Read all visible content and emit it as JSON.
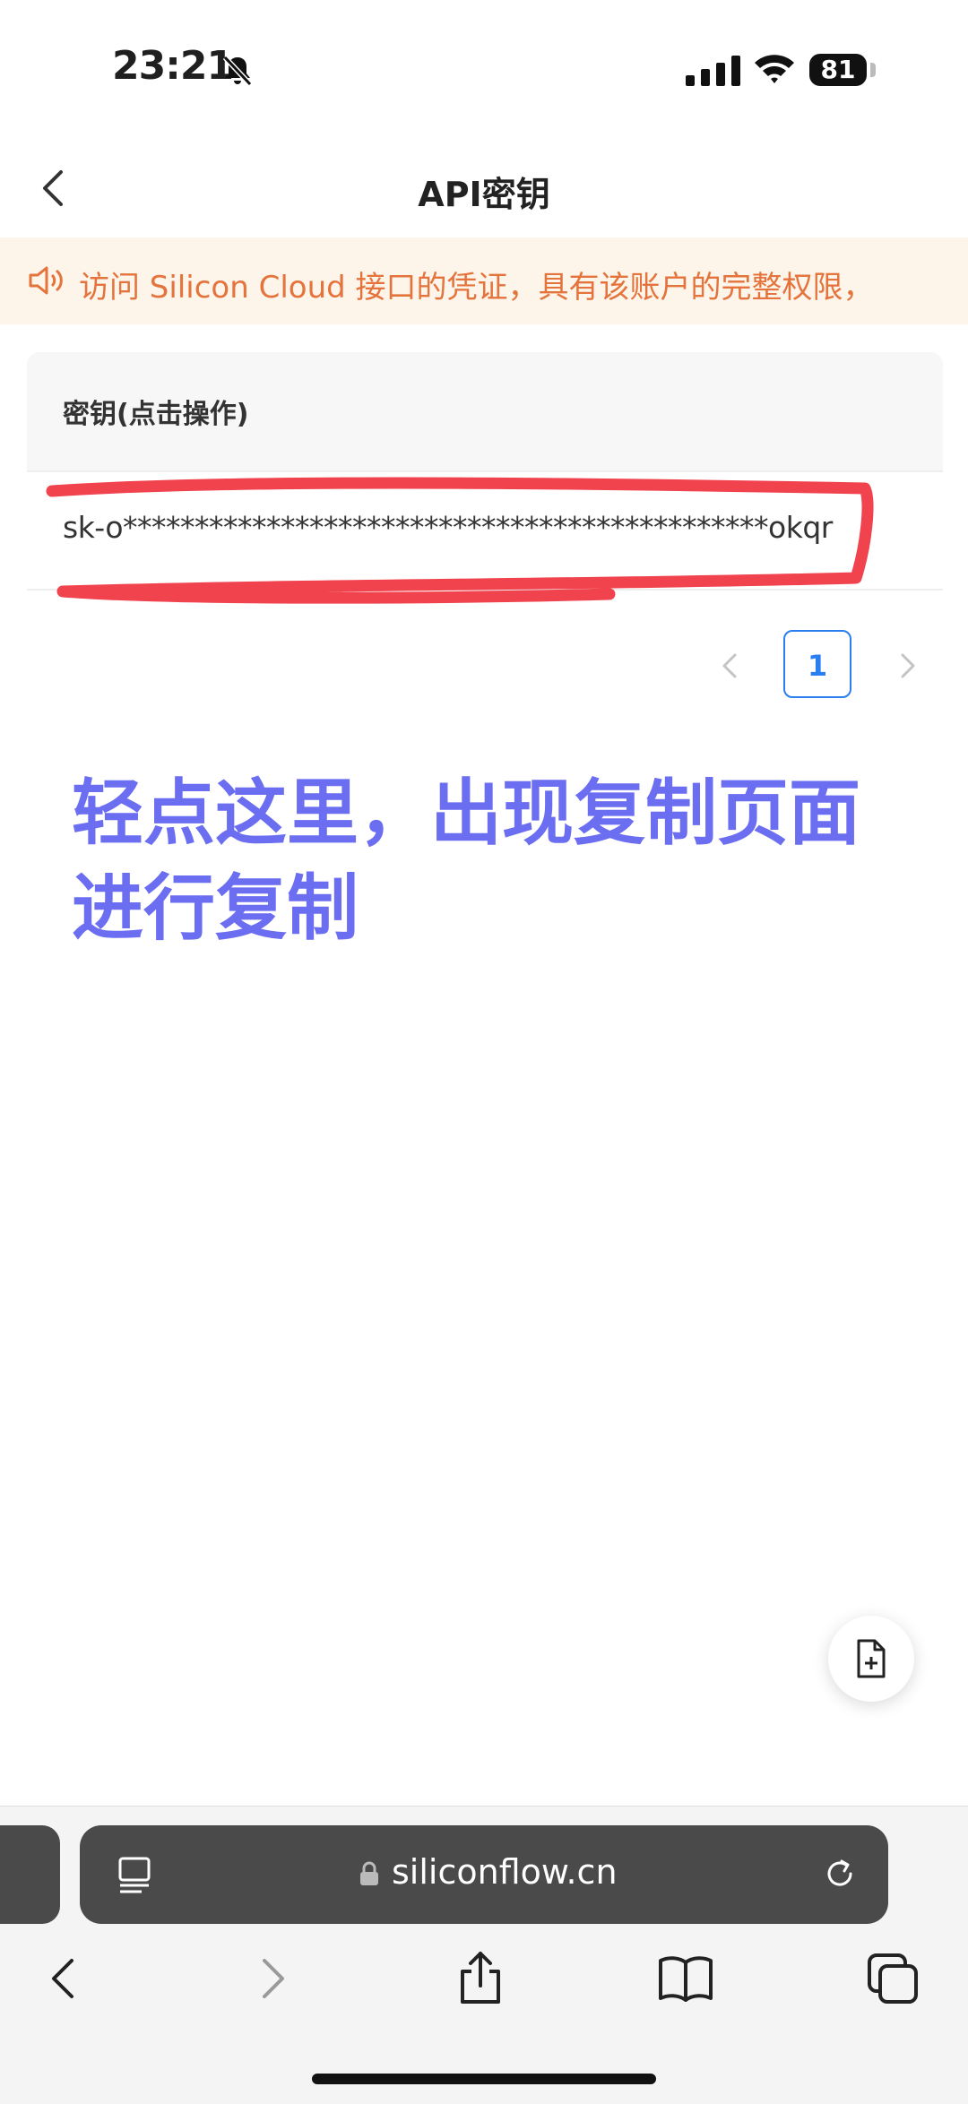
{
  "status_bar": {
    "time": "23:21",
    "battery": "81"
  },
  "header": {
    "title": "API密钥"
  },
  "notice": {
    "text": "访问 Silicon Cloud 接口的凭证，具有该账户的完整权限，"
  },
  "table": {
    "header": "密钥(点击操作)",
    "rows": [
      {
        "key": "sk-o*********************************************okqr"
      }
    ]
  },
  "pagination": {
    "current": "1"
  },
  "annotation": {
    "line1": "轻点这里，出现复制页面",
    "line2": "进行复制"
  },
  "browser": {
    "url": "siliconflow.cn"
  },
  "colors": {
    "accent": "#2a7ff0",
    "notice_text": "#e4733c",
    "annotation": "#6b6ef0",
    "highlight": "#f0434e"
  }
}
